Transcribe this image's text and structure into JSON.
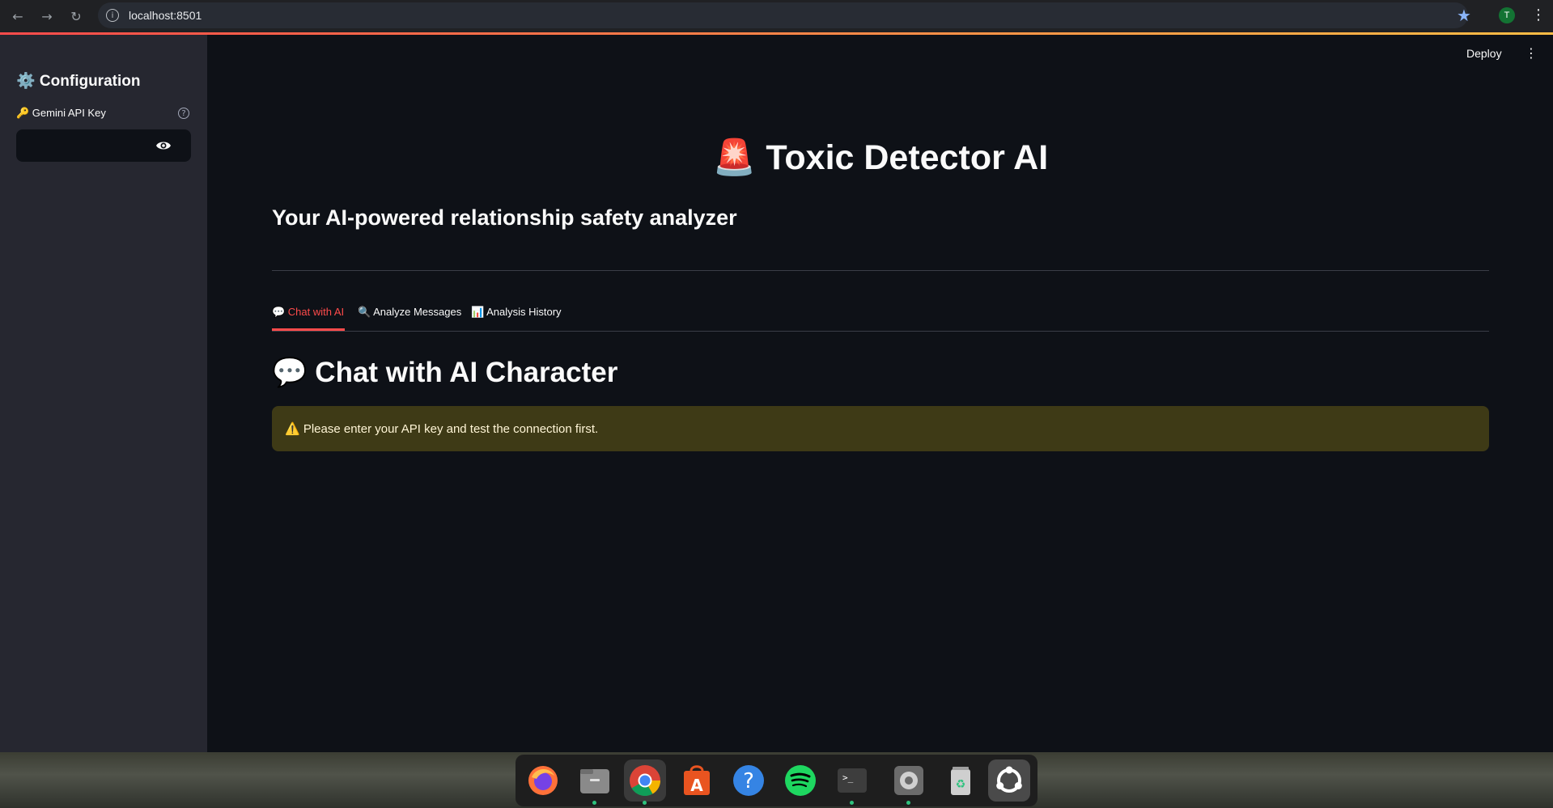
{
  "browser": {
    "url": "localhost:8501",
    "profile_initial": "T",
    "back_icon": "arrow-left-icon",
    "forward_icon": "arrow-right-icon",
    "reload_icon": "reload-icon"
  },
  "sidebar": {
    "title": "⚙️ Configuration",
    "api_key_label": "🔑 Gemini API Key",
    "help_icon": "?",
    "api_key_value": ""
  },
  "header": {
    "deploy_label": "Deploy",
    "menu_icon": "⋮"
  },
  "main": {
    "title": "🚨 Toxic Detector AI",
    "subtitle": "Your AI-powered relationship safety analyzer",
    "tabs": [
      {
        "label": "💬 Chat with AI",
        "active": true
      },
      {
        "label": "🔍 Analyze Messages",
        "active": false
      },
      {
        "label": "📊 Analysis History",
        "active": false
      }
    ],
    "section_title": "💬 Chat with AI Character",
    "warning": "⚠️ Please enter your API key and test the connection first."
  },
  "dock": {
    "apps": [
      "firefox-icon",
      "files-icon",
      "chrome-icon",
      "app-center-icon",
      "help-icon",
      "spotify-icon",
      "terminal-icon",
      "settings-icon",
      "trash-icon",
      "ubuntu-apps-icon"
    ]
  },
  "colors": {
    "accent": "#ff4b4b",
    "background": "#0e1117",
    "sidebar": "#262730",
    "warning_bg": "#3e3a16"
  }
}
